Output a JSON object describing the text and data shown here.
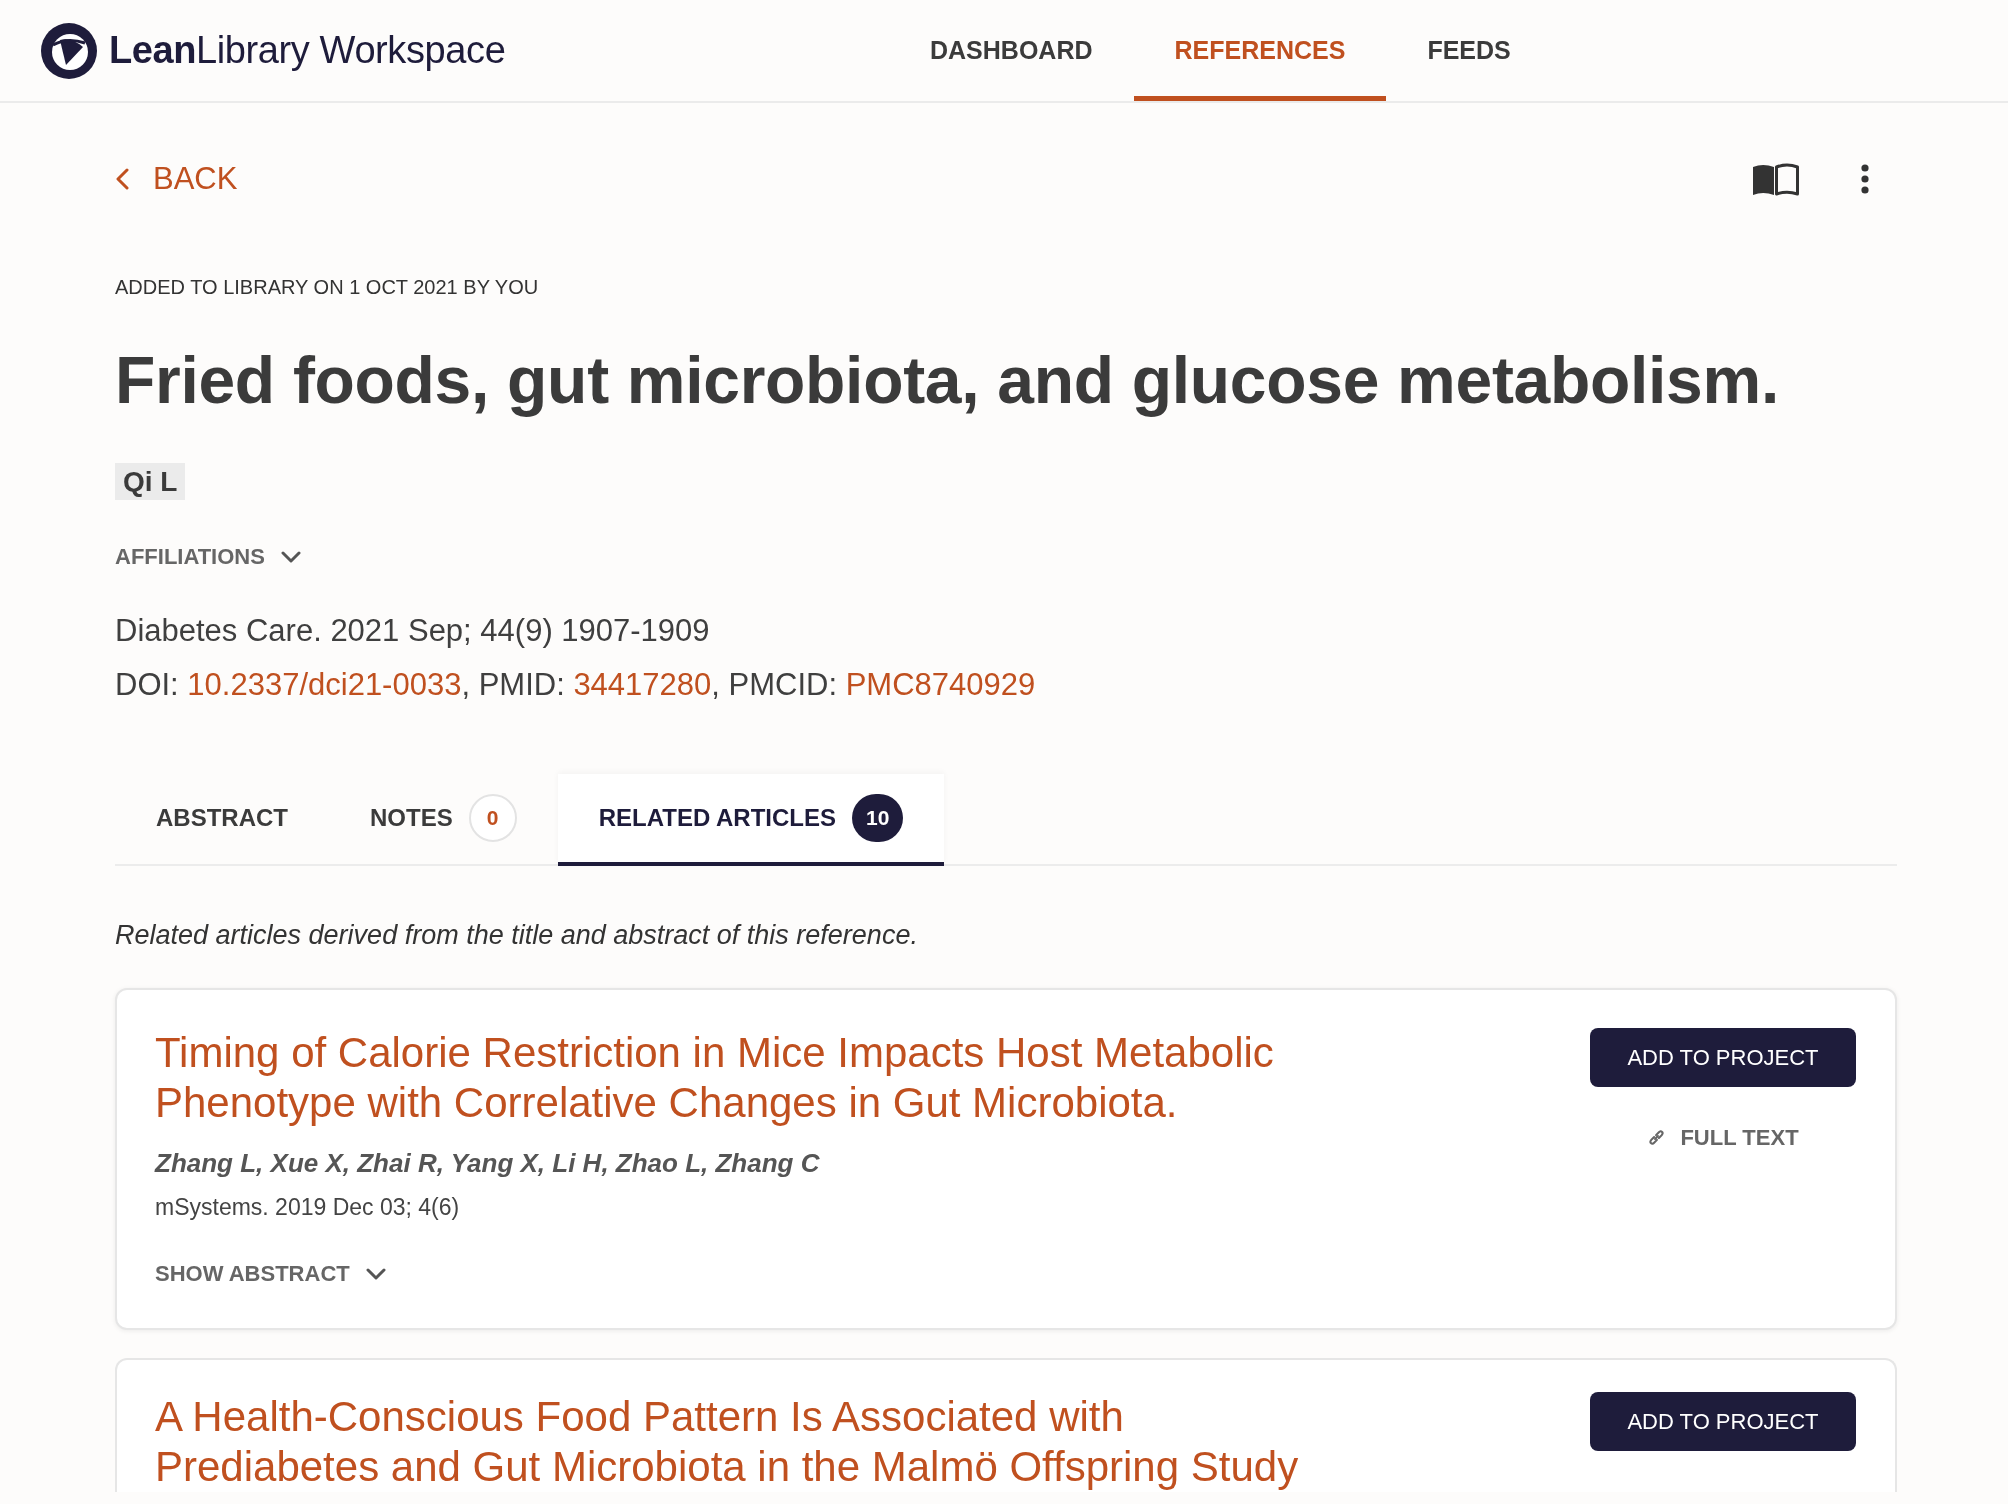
{
  "header": {
    "logo": "**Lean**Library Workspace",
    "nav": [
      {
        "label": "DASHBOARD",
        "selected": false
      },
      {
        "label": "REFERENCES",
        "selected": true
      },
      {
        "label": "FEEDS",
        "selected": false
      }
    ]
  },
  "back_link": "BACK",
  "reference": {
    "added": "ADDED TO LIBRARY ON 1 OCT 2021 BY YOU",
    "title": "Fried foods, gut microbiota, and glucose metabolism.",
    "authors": [
      "Qi L"
    ],
    "affiliations": {
      "label": "AFFILIATIONS",
      "expanded": false
    },
    "citation": "Diabetes Care. 2021 Sep; 44(9) 1907-1909",
    "identifiers": [
      {
        "label": "DOI: ",
        "value": "10.2337/dci21-0033"
      },
      {
        "label": ", PMID: ",
        "value": "34417280"
      },
      {
        "label": ", PMCID: ",
        "value": "PMC8740929"
      }
    ]
  },
  "tabs": [
    {
      "label": "ABSTRACT",
      "selected": false
    },
    {
      "label": "NOTES",
      "count": "0",
      "selected": false
    },
    {
      "label": "RELATED ARTICLES",
      "count": "10",
      "selected": true
    }
  ],
  "related": {
    "intro": "Related articles derived from the title and abstract of this reference.",
    "articles": [
      {
        "title": "Timing of Calorie Restriction in Mice Impacts Host Metabolic Phenotype with Correlative Changes in Gut Microbiota.",
        "authors": "Zhang L, Xue X, Zhai R, Yang X, Li H, Zhao L, Zhang C",
        "journal": "mSystems. 2019 Dec 03; 4(6)",
        "abstract_toggle": {
          "label": "SHOW ABSTRACT",
          "expanded": false
        },
        "add_button": "ADD TO PROJECT",
        "full_text": "FULL TEXT"
      },
      {
        "title": "A Health-Conscious Food Pattern Is Associated with Prediabetes and Gut Microbiota in the Malmö Offspring Study",
        "add_button": "ADD TO PROJECT"
      }
    ]
  }
}
